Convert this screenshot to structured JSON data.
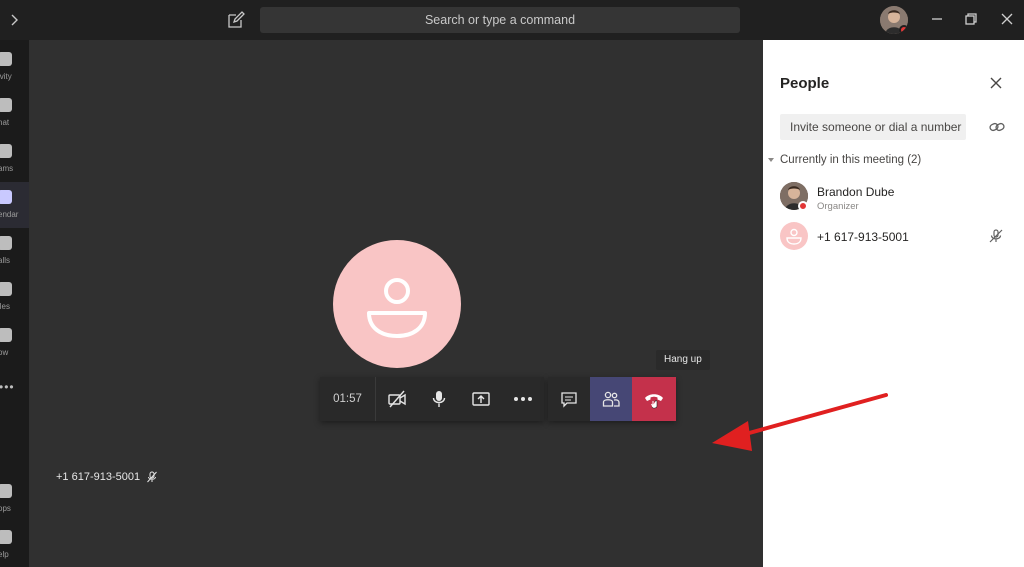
{
  "titlebar": {
    "search_placeholder": "Search or type a command"
  },
  "rail": {
    "items": [
      {
        "label": "ivity",
        "icon": "bell-icon"
      },
      {
        "label": "hat",
        "icon": "chat-icon"
      },
      {
        "label": "ams",
        "icon": "teams-icon"
      },
      {
        "label": "endar",
        "icon": "calendar-icon"
      },
      {
        "label": "alls",
        "icon": "calls-icon"
      },
      {
        "label": "iles",
        "icon": "files-icon"
      },
      {
        "label": "ow",
        "icon": "now-icon"
      },
      {
        "label": "ops",
        "icon": "apps-icon"
      },
      {
        "label": "elp",
        "icon": "help-icon"
      }
    ]
  },
  "stage": {
    "caller_number": "+1 617-913-5001"
  },
  "controls": {
    "timer": "01:57",
    "tooltip": "Hang up"
  },
  "panel": {
    "title": "People",
    "invite_placeholder": "Invite someone or dial a number",
    "section_label": "Currently in this meeting (2)",
    "participants": [
      {
        "name": "Brandon Dube",
        "role": "Organizer"
      },
      {
        "name": "+1 617-913-5001",
        "role": ""
      }
    ]
  },
  "colors": {
    "hangup": "#c4314b",
    "people_active": "#464775",
    "avatar_pink": "#f9c5c5",
    "annotation_red": "#e02020"
  }
}
